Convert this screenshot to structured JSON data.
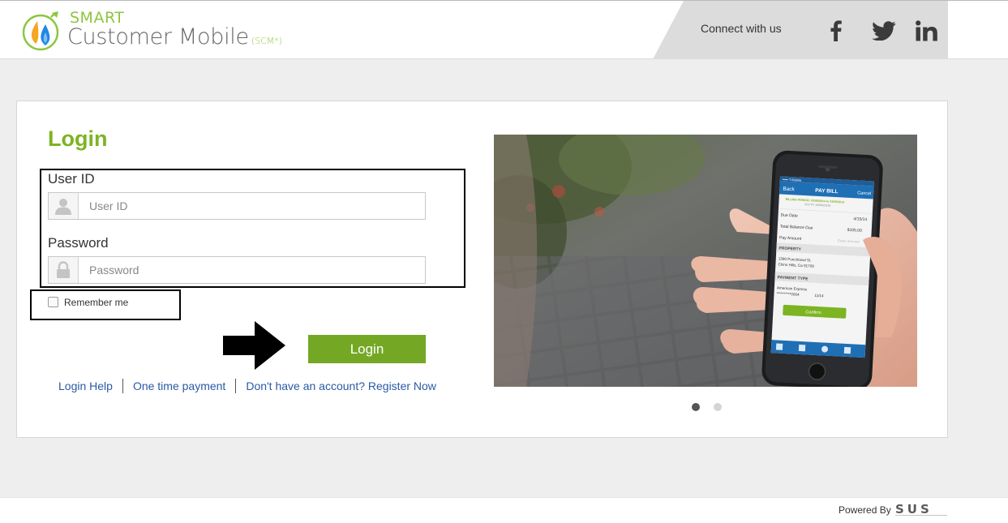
{
  "brand": {
    "smart": "SMART",
    "name": "Customer Mobile",
    "suffix": "(SCM*)"
  },
  "header": {
    "connect_text": "Connect with us",
    "social": [
      "facebook-icon",
      "twitter-icon",
      "linkedin-icon"
    ]
  },
  "login": {
    "title": "Login",
    "user_label": "User ID",
    "user_placeholder": "User ID",
    "user_value": "",
    "password_label": "Password",
    "password_placeholder": "Password",
    "password_value": "",
    "remember_label": "Remember me",
    "remember_checked": false,
    "button_label": "Login"
  },
  "links": {
    "help": "Login Help",
    "one_time": "One time payment",
    "register": "Don't have an account? Register Now"
  },
  "phone_screen": {
    "carrier": "••••• T-Mobile",
    "back": "Back",
    "title": "PAY BILL",
    "cancel": "Cancel",
    "billing_period": "BILLING PERIOD: 03/05/2014 to 03/05/2014",
    "account": "ACCT#: 3468923230",
    "due_date_label": "Due Date",
    "due_date_value": "4/15/14",
    "balance_label": "Total Balance Due",
    "balance_value": "$105.00",
    "pay_amount_label": "Pay Amount",
    "pay_amount_placeholder": "Enter Amount",
    "property_heading": "PROPERTY",
    "property_line1": "1390 Punchbowl St.",
    "property_line2": "Chino Hills, Ca 91709",
    "payment_type_heading": "PAYMENT TYPE",
    "card_name": "American Express",
    "card_number": "**********0004",
    "card_exp": "11/14",
    "confirm": "Confirm"
  },
  "carousel": {
    "slides": 2,
    "active": 1
  },
  "footer": {
    "powered_by": "Powered By",
    "logo_text": "SUS"
  },
  "colors": {
    "brand_green": "#7cb422",
    "button_green": "#74a824",
    "link_blue": "#2a5aa5",
    "header_panel": "#dcdcdc",
    "page_bg": "#eeeeee"
  }
}
